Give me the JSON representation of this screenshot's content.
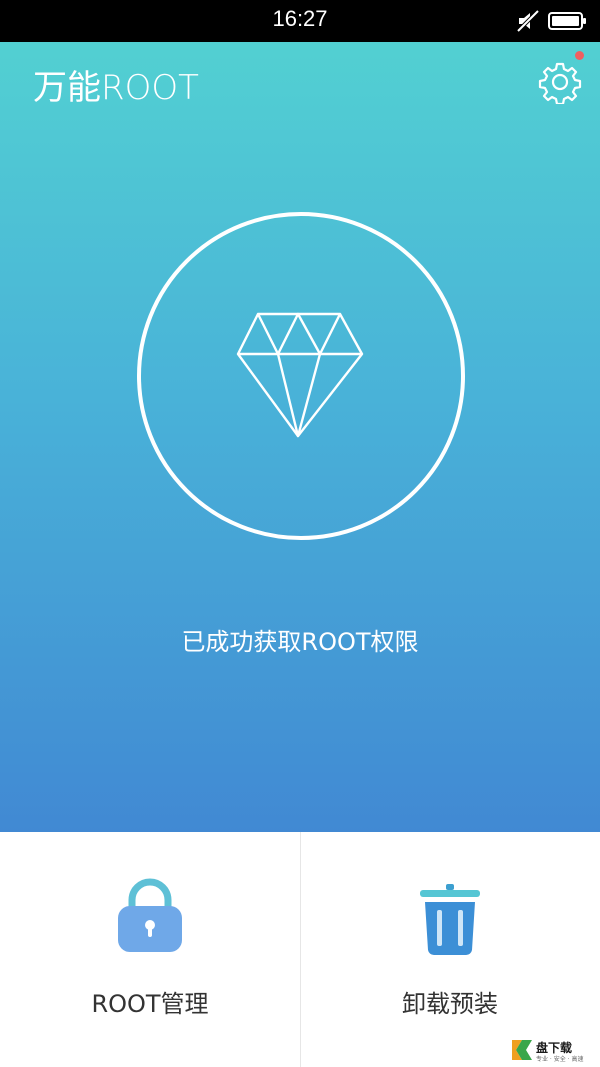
{
  "status_bar": {
    "time": "16:27"
  },
  "header": {
    "title": "万能ROOT"
  },
  "main": {
    "status_text": "已成功获取ROOT权限"
  },
  "actions": [
    {
      "label": "ROOT管理",
      "icon": "lock-icon"
    },
    {
      "label": "卸载预装",
      "icon": "trash-icon"
    }
  ],
  "watermark": {
    "text": "盘下载",
    "sub": "专业 · 安全 · 高速"
  },
  "colors": {
    "gradient_top": "#52d0d2",
    "gradient_bottom": "#4189d3",
    "notification": "#ef5f60",
    "lock_icon": "#6fa8e8",
    "trash_icon": "#3c9fd0"
  }
}
